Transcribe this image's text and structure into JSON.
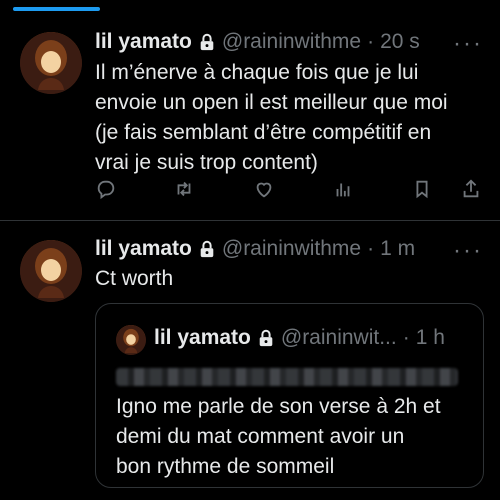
{
  "colors": {
    "accent": "#1d9bf0",
    "background": "#000000",
    "muted": "#71767b",
    "text": "#e7e9ea"
  },
  "tweets": [
    {
      "name": "lil yamato",
      "handle": "@raininwithme",
      "sep": "·",
      "time": "20 s",
      "more": "···",
      "text": "Il m’énerve à chaque fois que je lui\nenvoie un open il est meilleur que moi\n(je fais semblant d’être compétitif en\nvrai je suis trop content)",
      "icons": [
        "reply-icon",
        "retweet-icon",
        "like-icon",
        "views-icon",
        "bookmark-icon",
        "share-icon"
      ]
    },
    {
      "name": "lil yamato",
      "handle": "@raininwithme",
      "sep": "·",
      "time": "1 m",
      "more": "···",
      "text": "Ct worth",
      "quote": {
        "name": "lil yamato",
        "handle": "@raininwit...",
        "sep": "·",
        "time": "1 h",
        "text": "Igno me parle de son verse à 2h et\ndemi du mat comment avoir un\nbon rythme de sommeil"
      }
    }
  ]
}
